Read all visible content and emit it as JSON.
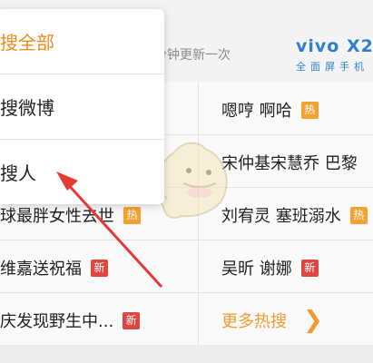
{
  "header": {
    "update_text": "分钟更新一次",
    "ad": {
      "brand": "vivo X20",
      "tagline": "全面屏手机"
    }
  },
  "menu": {
    "items": [
      {
        "label": "搜全部",
        "active": true
      },
      {
        "label": "搜微博",
        "active": false
      },
      {
        "label": "搜人",
        "active": false
      }
    ]
  },
  "hot_list": {
    "right_col": [
      {
        "text": "嗯哼 啊哈",
        "badge": "热"
      },
      {
        "text": "宋仲基宋慧乔 巴黎",
        "badge": ""
      },
      {
        "text": "刘宥灵 塞班溺水",
        "badge": "热"
      },
      {
        "text": "吴昕 谢娜",
        "badge": "新"
      }
    ],
    "left_col": [
      {
        "text": "球最胖女性去世",
        "badge": "热"
      },
      {
        "text": "维嘉送祝福",
        "badge": "新"
      },
      {
        "text": "庆发现野生中...",
        "badge": "新"
      }
    ],
    "more": {
      "label": "更多热搜",
      "icon": "chevron-right"
    }
  },
  "colors": {
    "accent": "#f08a1c",
    "hot_badge": "#f4a231",
    "new_badge": "#e0463f",
    "annotation_arrow": "#e53935",
    "ad_blue": "#2f7fd0"
  }
}
